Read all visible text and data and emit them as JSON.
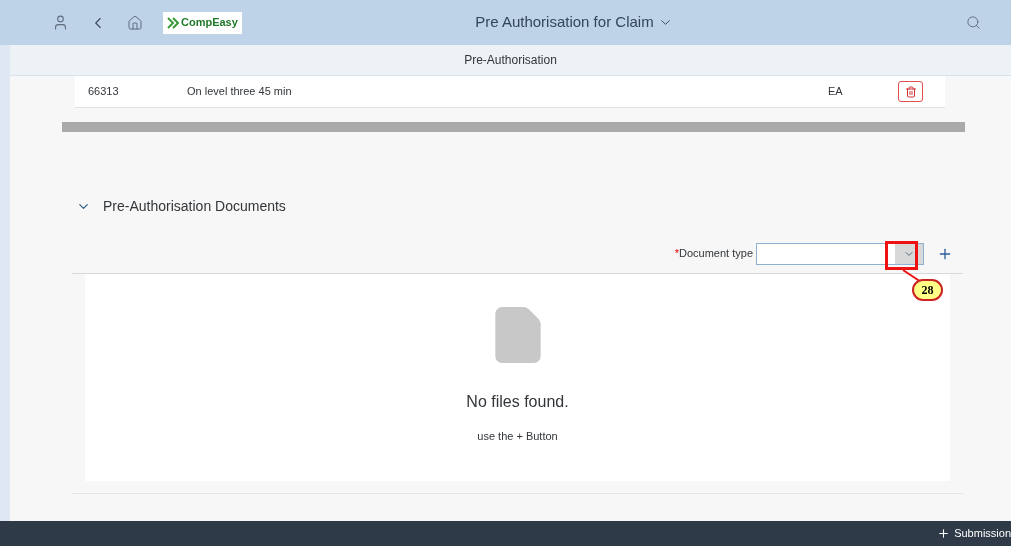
{
  "header": {
    "logo": "CompEasy",
    "title": "Pre Authorisation for Claim"
  },
  "subheader": {
    "title": "Pre-Authorisation"
  },
  "table": {
    "rows": [
      {
        "cells": [
          "66313",
          "On level three 45 min",
          "EA"
        ]
      }
    ]
  },
  "documents": {
    "title": "Pre-Authorisation Documents",
    "expanded": true,
    "field": {
      "required_mark": "*",
      "label": "Document type"
    },
    "empty_title": "No files found.",
    "empty_hint": "use the + Button"
  },
  "callout": {
    "number": "28"
  },
  "footer": {
    "button": "Submission"
  }
}
